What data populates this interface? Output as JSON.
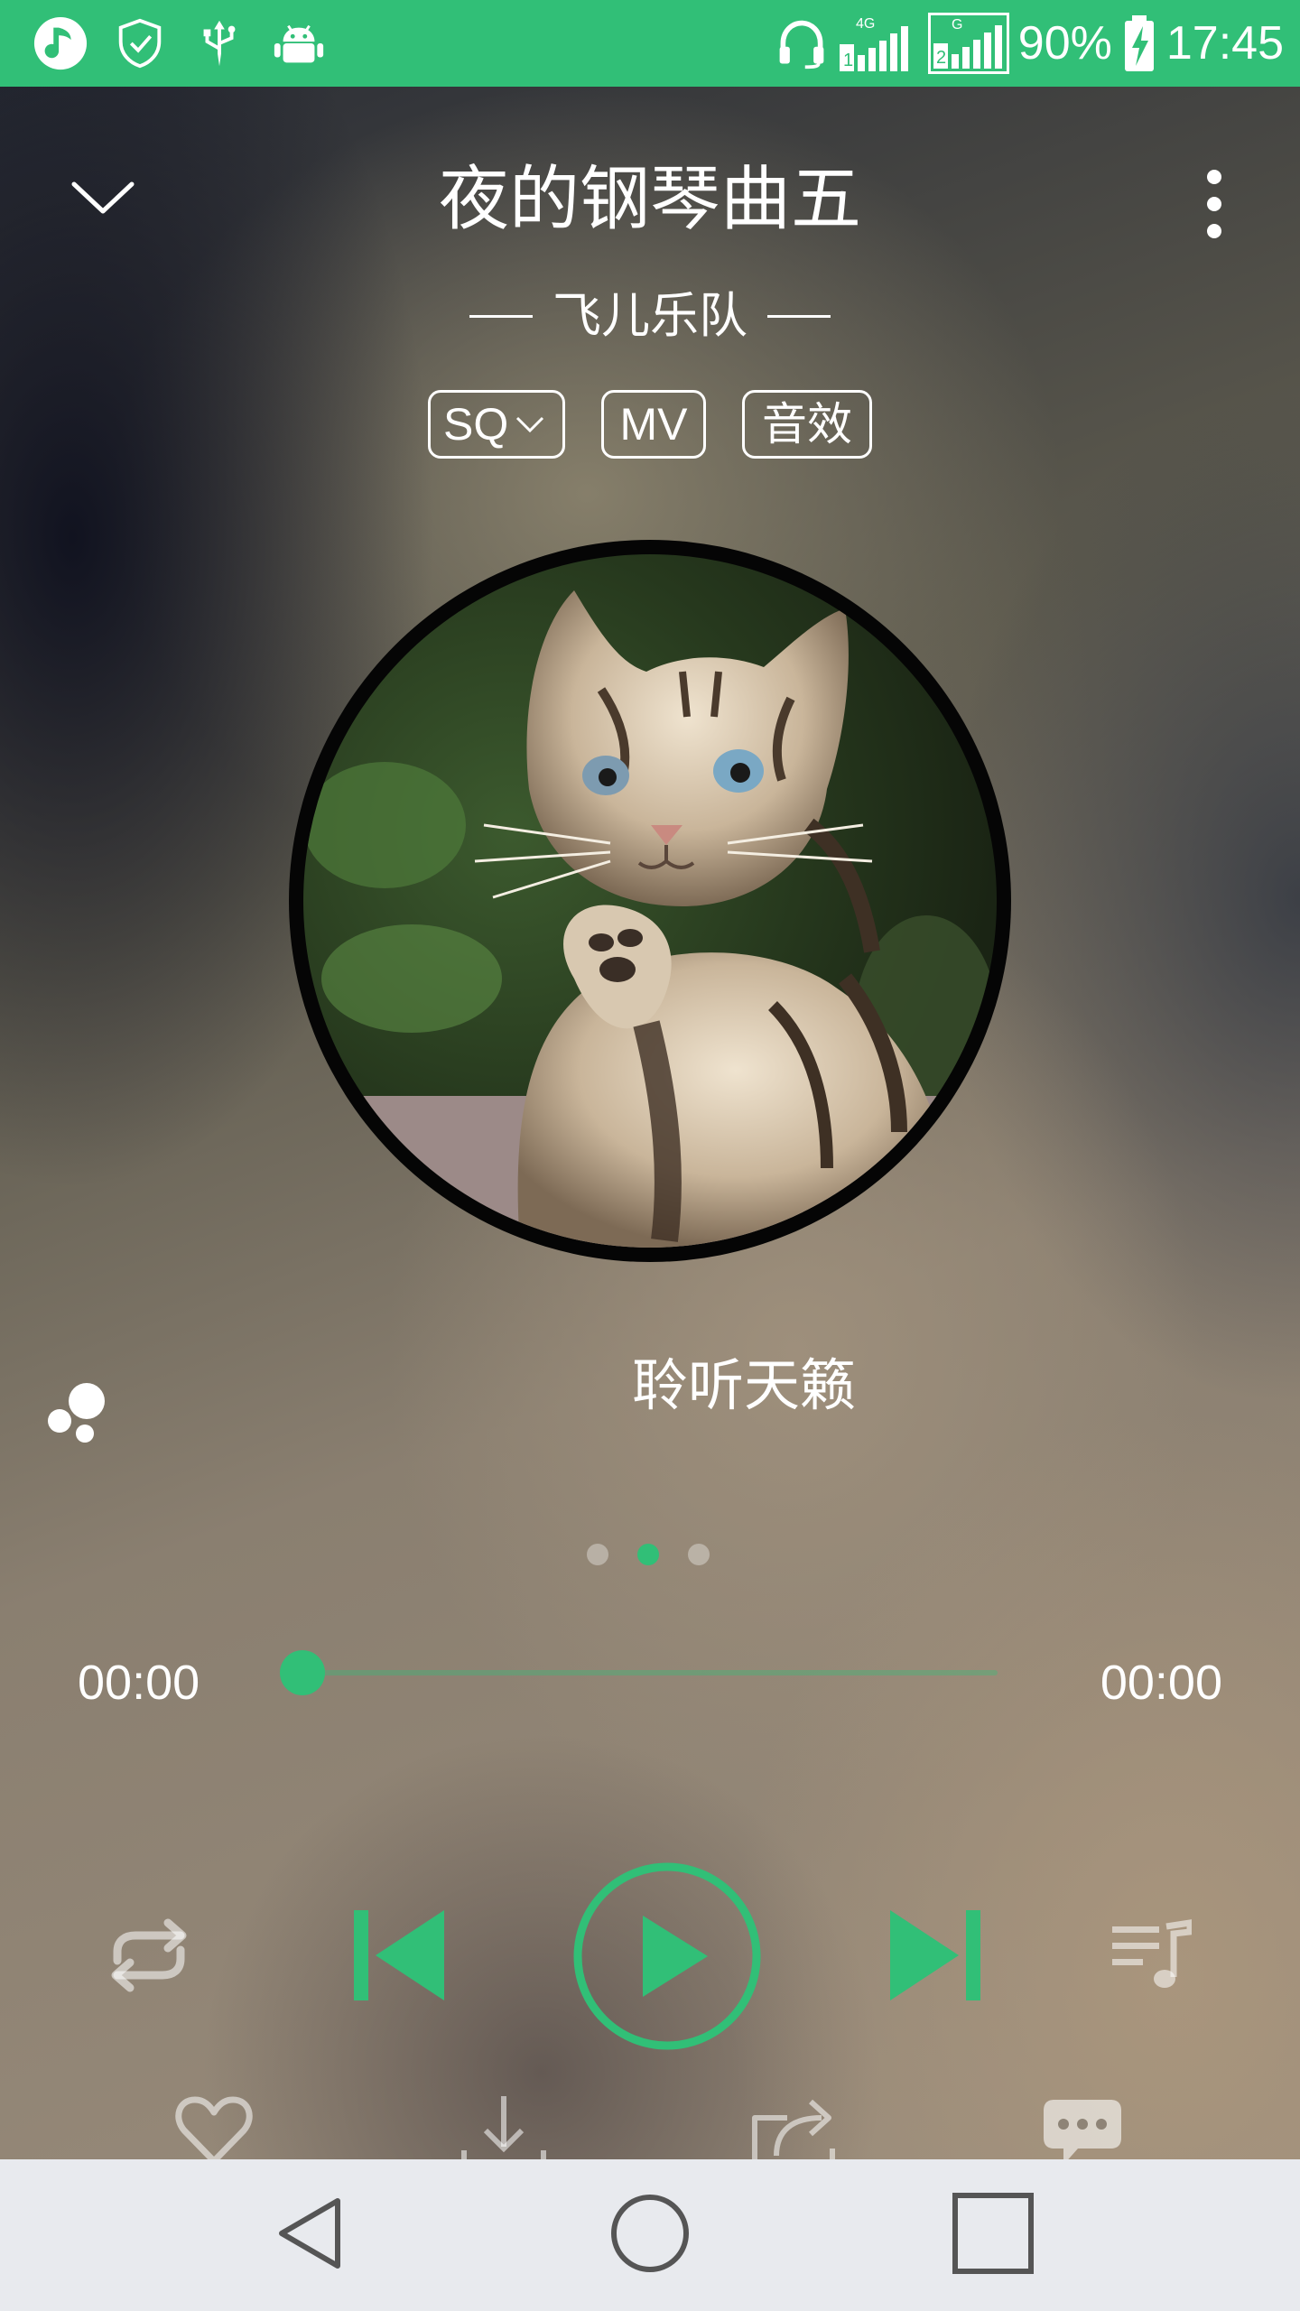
{
  "status_bar": {
    "battery_percent": "90%",
    "time": "17:45",
    "network_4g": "4G",
    "network_g": "G",
    "sim1": "1",
    "sim2": "2",
    "icons": [
      "qq-music-icon",
      "shield-icon",
      "usb-icon",
      "android-debug-icon",
      "headset-icon",
      "signal-icon",
      "battery-charging-icon"
    ]
  },
  "player": {
    "song_title": "夜的钢琴曲五",
    "artist": "飞儿乐队",
    "tags": {
      "quality": "SQ",
      "mv": "MV",
      "sound_effect": "音效"
    },
    "lyric": "聆听天籁",
    "page_dots": {
      "count": 3,
      "active_index": 1
    },
    "progress": {
      "elapsed": "00:00",
      "duration": "00:00",
      "fraction": 0.0
    },
    "accent_color": "#31bf77"
  },
  "controls": {
    "icons": [
      "repeat-icon",
      "previous-icon",
      "play-icon",
      "next-icon",
      "playlist-icon"
    ],
    "actions": [
      "heart-icon",
      "download-icon",
      "share-icon",
      "comment-icon"
    ]
  },
  "nav_bar": {
    "icons": [
      "back-icon",
      "home-icon",
      "recents-icon"
    ]
  }
}
